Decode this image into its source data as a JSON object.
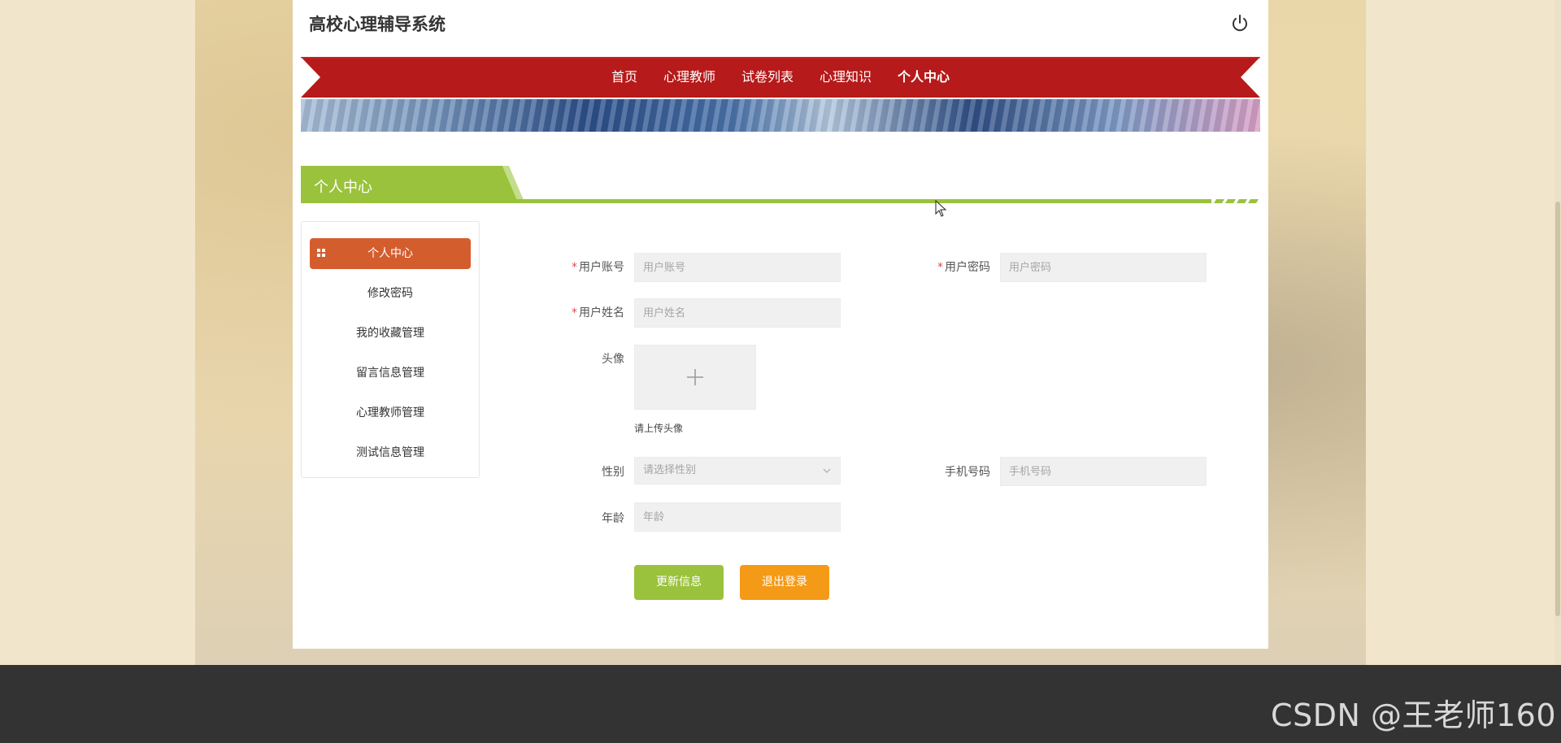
{
  "header": {
    "site_title": "高校心理辅导系统",
    "power_icon": "power-icon"
  },
  "nav": {
    "items": [
      {
        "label": "首页"
      },
      {
        "label": "心理教师"
      },
      {
        "label": "试卷列表"
      },
      {
        "label": "心理知识"
      },
      {
        "label": "个人中心",
        "active": true
      }
    ]
  },
  "section": {
    "title": "个人中心"
  },
  "sidebar": {
    "items": [
      {
        "label": "个人中心",
        "active": true
      },
      {
        "label": "修改密码"
      },
      {
        "label": "我的收藏管理"
      },
      {
        "label": "留言信息管理"
      },
      {
        "label": "心理教师管理"
      },
      {
        "label": "测试信息管理"
      }
    ]
  },
  "form": {
    "account": {
      "label": "用户账号",
      "placeholder": "用户账号",
      "required": true
    },
    "password": {
      "label": "用户密码",
      "placeholder": "用户密码",
      "required": true
    },
    "name": {
      "label": "用户姓名",
      "placeholder": "用户姓名",
      "required": true
    },
    "avatar": {
      "label": "头像",
      "hint": "请上传头像"
    },
    "gender": {
      "label": "性别",
      "placeholder": "请选择性别"
    },
    "phone": {
      "label": "手机号码",
      "placeholder": "手机号码"
    },
    "age": {
      "label": "年龄",
      "placeholder": "年龄"
    },
    "required_mark": "*"
  },
  "buttons": {
    "update": "更新信息",
    "logout": "退出登录"
  },
  "watermark": "CSDN @王老师160",
  "colors": {
    "nav_red": "#b61a1a",
    "section_green": "#9ac23c",
    "sidebar_active": "#d45d2e",
    "logout_orange": "#f59a17",
    "footer": "#333333"
  }
}
